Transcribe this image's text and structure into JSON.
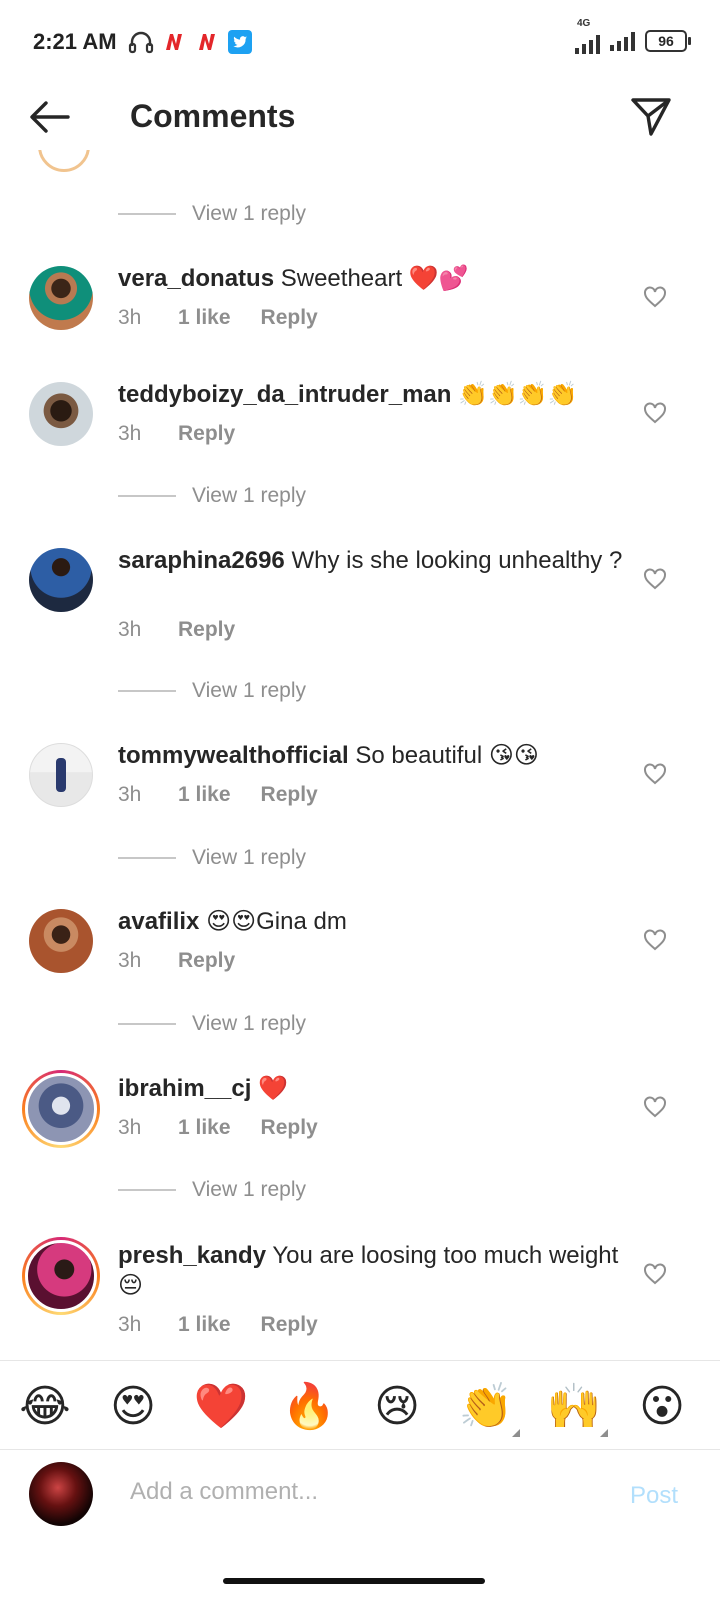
{
  "status_bar": {
    "time": "2:21 AM",
    "network": "4G",
    "battery": "96"
  },
  "header": {
    "title": "Comments"
  },
  "comments": [
    {
      "view_reply_before": "View 1 reply",
      "username": "vera_donatus",
      "text": "Sweetheart ❤️💕",
      "time": "3h",
      "likes": "1 like",
      "reply": "Reply"
    },
    {
      "username": "teddyboizy_da_intruder_man",
      "text": "👏👏👏👏",
      "time": "3h",
      "likes": "",
      "reply": "Reply"
    },
    {
      "view_reply_before": "View 1 reply",
      "username": "saraphina2696",
      "text": "Why is she looking unhealthy ?",
      "time": "3h",
      "likes": "",
      "reply": "Reply"
    },
    {
      "view_reply_before": "View 1 reply",
      "username": "tommywealthofficial",
      "text": "So beautiful 😘😘",
      "time": "3h",
      "likes": "1 like",
      "reply": "Reply"
    },
    {
      "view_reply_before": "View 1 reply",
      "username": "avafilix",
      "text": "😍😍Gina dm",
      "time": "3h",
      "likes": "",
      "reply": "Reply"
    },
    {
      "view_reply_before": "View 1 reply",
      "username": "ibrahim__cj",
      "text": "❤️",
      "time": "3h",
      "likes": "1 like",
      "reply": "Reply"
    },
    {
      "view_reply_before": "View 1 reply",
      "username": "presh_kandy",
      "text": "You are loosing too much weight 😔",
      "time": "3h",
      "likes": "1 like",
      "reply": "Reply"
    }
  ],
  "view_replies": [
    "View 1 reply",
    "View 1 reply",
    "View 1 reply",
    "View 1 reply",
    "View 1 reply",
    "View 1 reply"
  ],
  "emoji_bar": [
    "😂",
    "😍",
    "❤️",
    "🔥",
    "😢",
    "👏",
    "🙌",
    "😮"
  ],
  "composer": {
    "placeholder": "Add a comment...",
    "post_label": "Post"
  },
  "colors": {
    "accent_disabled": "#b2dffc",
    "secondary_text": "#8e8e8e"
  }
}
